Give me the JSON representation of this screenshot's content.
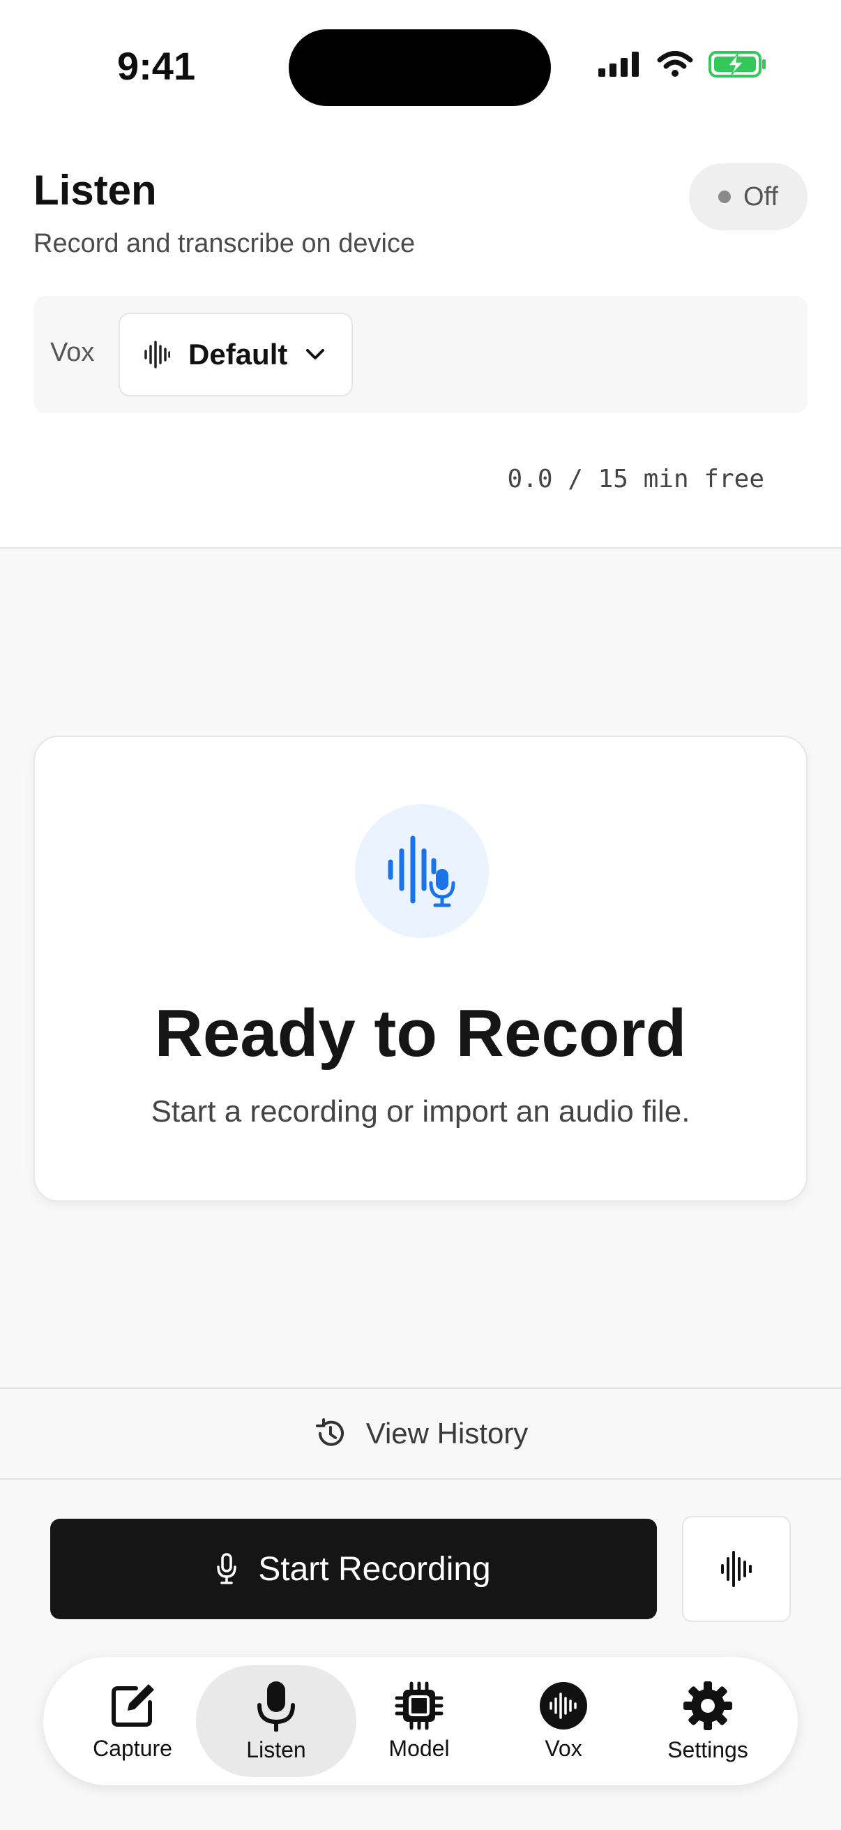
{
  "status_bar": {
    "time": "9:41"
  },
  "header": {
    "title": "Listen",
    "subtitle": "Record and transcribe on device",
    "status": "Off",
    "vox_label": "Vox",
    "vox_selected": "Default",
    "quota": "0.0 / 15 min free"
  },
  "ready": {
    "title": "Ready to Record",
    "subtitle": "Start a recording or import an audio file."
  },
  "history": {
    "label": "View History"
  },
  "actions": {
    "record_label": "Start Recording"
  },
  "tabs": [
    {
      "label": "Capture",
      "icon": "compose-icon"
    },
    {
      "label": "Listen",
      "icon": "mic-icon",
      "active": true
    },
    {
      "label": "Model",
      "icon": "chip-icon"
    },
    {
      "label": "Vox",
      "icon": "waveform-circle-icon"
    },
    {
      "label": "Settings",
      "icon": "gear-icon"
    }
  ],
  "colors": {
    "accent": "#1a73e8",
    "battery": "#34c759",
    "primary_button": "#151515"
  }
}
